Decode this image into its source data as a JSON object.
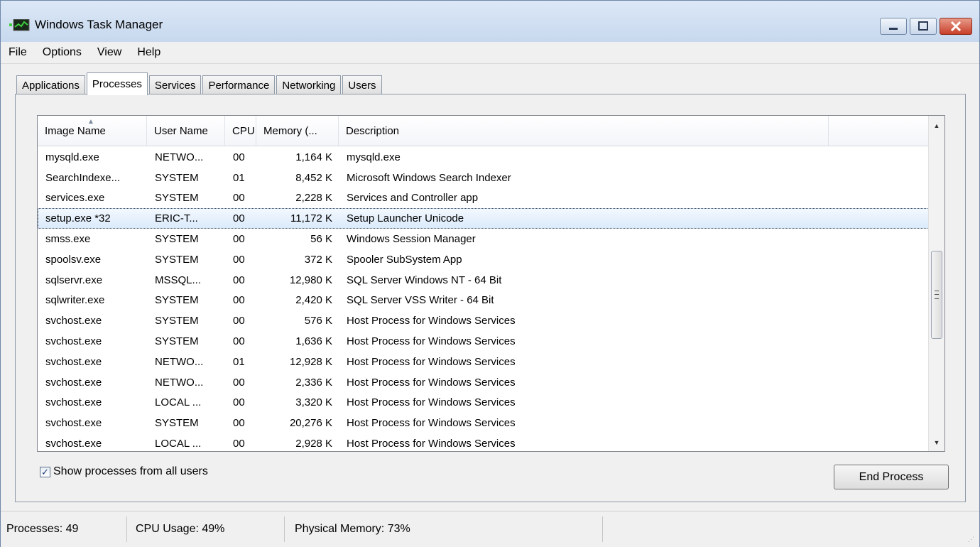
{
  "window": {
    "title": "Windows Task Manager"
  },
  "menu": [
    "File",
    "Options",
    "View",
    "Help"
  ],
  "tabs": [
    {
      "label": "Applications",
      "active": false
    },
    {
      "label": "Processes",
      "active": true
    },
    {
      "label": "Services",
      "active": false
    },
    {
      "label": "Performance",
      "active": false
    },
    {
      "label": "Networking",
      "active": false
    },
    {
      "label": "Users",
      "active": false
    }
  ],
  "columns": [
    "Image Name",
    "User Name",
    "CPU",
    "Memory (...",
    "Description"
  ],
  "processes": [
    {
      "name": "mysqld.exe",
      "user": "NETWO...",
      "cpu": "00",
      "mem": "1,164 K",
      "desc": "mysqld.exe"
    },
    {
      "name": "SearchIndexe...",
      "user": "SYSTEM",
      "cpu": "01",
      "mem": "8,452 K",
      "desc": "Microsoft Windows Search Indexer"
    },
    {
      "name": "services.exe",
      "user": "SYSTEM",
      "cpu": "00",
      "mem": "2,228 K",
      "desc": "Services and Controller app"
    },
    {
      "name": "setup.exe *32",
      "user": "ERIC-T...",
      "cpu": "00",
      "mem": "11,172 K",
      "desc": "Setup Launcher Unicode",
      "selected": true
    },
    {
      "name": "smss.exe",
      "user": "SYSTEM",
      "cpu": "00",
      "mem": "56 K",
      "desc": "Windows Session Manager"
    },
    {
      "name": "spoolsv.exe",
      "user": "SYSTEM",
      "cpu": "00",
      "mem": "372 K",
      "desc": "Spooler SubSystem App"
    },
    {
      "name": "sqlservr.exe",
      "user": "MSSQL...",
      "cpu": "00",
      "mem": "12,980 K",
      "desc": "SQL Server Windows NT - 64 Bit"
    },
    {
      "name": "sqlwriter.exe",
      "user": "SYSTEM",
      "cpu": "00",
      "mem": "2,420 K",
      "desc": "SQL Server VSS Writer - 64 Bit"
    },
    {
      "name": "svchost.exe",
      "user": "SYSTEM",
      "cpu": "00",
      "mem": "576 K",
      "desc": "Host Process for Windows Services"
    },
    {
      "name": "svchost.exe",
      "user": "SYSTEM",
      "cpu": "00",
      "mem": "1,636 K",
      "desc": "Host Process for Windows Services"
    },
    {
      "name": "svchost.exe",
      "user": "NETWO...",
      "cpu": "01",
      "mem": "12,928 K",
      "desc": "Host Process for Windows Services"
    },
    {
      "name": "svchost.exe",
      "user": "NETWO...",
      "cpu": "00",
      "mem": "2,336 K",
      "desc": "Host Process for Windows Services"
    },
    {
      "name": "svchost.exe",
      "user": "LOCAL ...",
      "cpu": "00",
      "mem": "3,320 K",
      "desc": "Host Process for Windows Services"
    },
    {
      "name": "svchost.exe",
      "user": "SYSTEM",
      "cpu": "00",
      "mem": "20,276 K",
      "desc": "Host Process for Windows Services"
    },
    {
      "name": "svchost.exe",
      "user": "LOCAL ...",
      "cpu": "00",
      "mem": "2,928 K",
      "desc": "Host Process for Windows Services"
    }
  ],
  "show_all_users": {
    "label": "Show processes from all users",
    "checked": true
  },
  "end_process_label": "End Process",
  "status": {
    "processes": "Processes: 49",
    "cpu": "CPU Usage: 49%",
    "memory": "Physical Memory: 73%"
  },
  "icons": {
    "app": "task-manager-icon",
    "minimize": "minimize-icon",
    "maximize": "maximize-icon",
    "close": "close-icon",
    "sort": "sort-ascending-icon",
    "scroll_up": "scroll-up-arrow-icon",
    "scroll_down": "scroll-down-arrow-icon",
    "checkmark": "checkmark-icon"
  }
}
